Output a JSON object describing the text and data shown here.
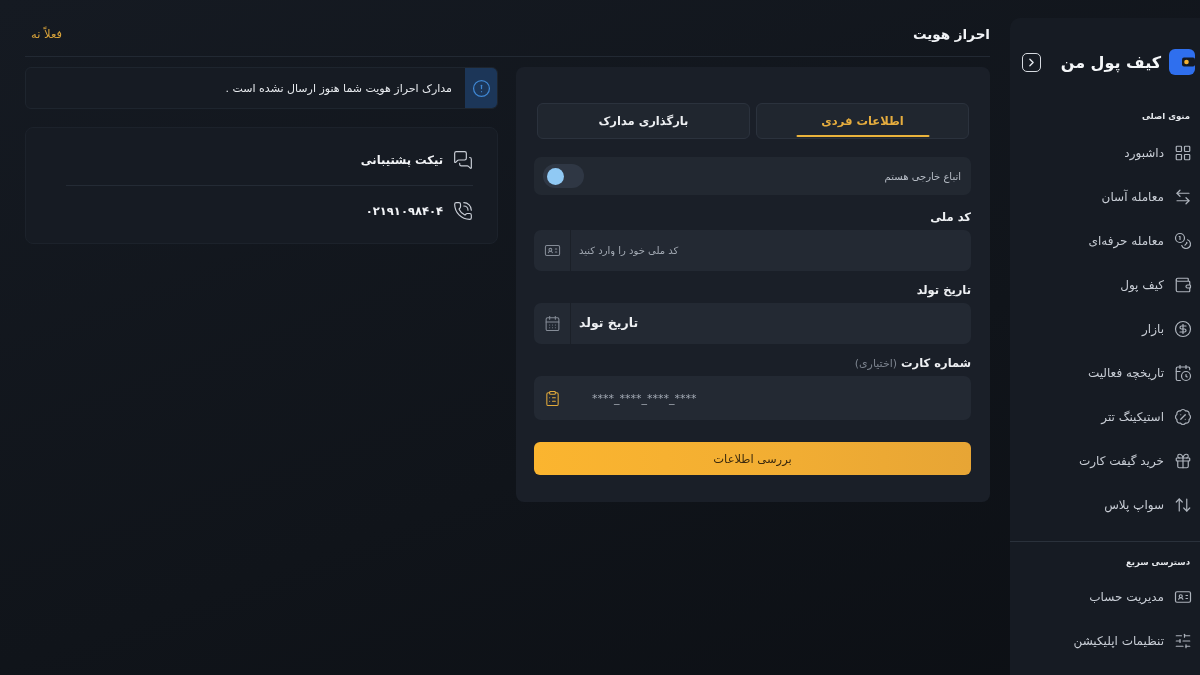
{
  "sidebar": {
    "logo_text": "کیف پول من",
    "sections": [
      {
        "title": "منوی اصلی",
        "items": [
          {
            "label": "داشبورد",
            "selected": false
          },
          {
            "label": "معامله آسان",
            "selected": false
          },
          {
            "label": "معامله حرفه‌ای",
            "selected": false
          },
          {
            "label": "کیف پول",
            "selected": false
          },
          {
            "label": "بازار",
            "selected": false
          },
          {
            "label": "تاریخچه فعالیت",
            "selected": false
          },
          {
            "label": "استیکینگ تتر",
            "selected": false
          },
          {
            "label": "خرید گیفت کارت",
            "selected": false
          },
          {
            "label": "سواپ پلاس",
            "selected": false
          }
        ]
      },
      {
        "title": "دسترسی سریع",
        "items": [
          {
            "label": "مدیریت حساب",
            "selected": false
          },
          {
            "label": "تنظیمات اپلیکیشن",
            "selected": false
          }
        ]
      }
    ]
  },
  "header": {
    "title": "احراز هویت",
    "skip_link": "فعلاً نه"
  },
  "form": {
    "tabs": [
      {
        "label": "اطلاعات فردی",
        "selected": true
      },
      {
        "label": "بارگذاری مدارک",
        "selected": false
      }
    ],
    "toggle": {
      "label": "اتباع خارجی هستم",
      "on": false
    },
    "fields": [
      {
        "kind": "text",
        "label": "کد ملی",
        "placeholder": "کد ملی خود را وارد کنید"
      },
      {
        "kind": "date",
        "label": "تاریخ تولد",
        "placeholder": "تاریخ تولد"
      },
      {
        "kind": "card",
        "label": "شماره کارت",
        "hint": "(اختیاری)",
        "placeholder": "****_****_****_****"
      }
    ],
    "submit_button": "بررسی اطلاعات"
  },
  "alert": {
    "text": "مدارک احراز هویت شما هنوز ارسال نشده است ."
  },
  "support": [
    {
      "kind": "ticket",
      "label": "تیکت پشتیبانی"
    },
    {
      "kind": "phone",
      "label": "۰۲۱۹۱۰۹۸۴۰۴"
    }
  ]
}
